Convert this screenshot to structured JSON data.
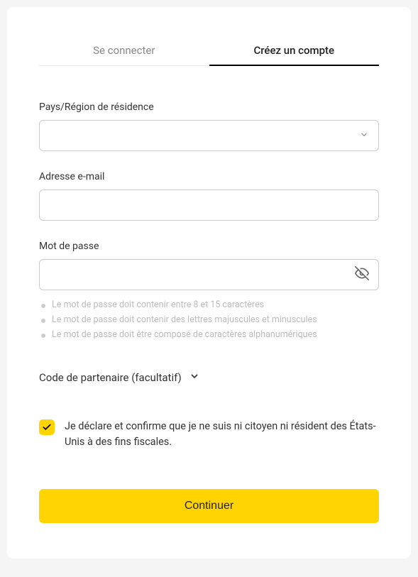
{
  "tabs": {
    "login": "Se connecter",
    "signup": "Créez un compte"
  },
  "form": {
    "country": {
      "label": "Pays/Région de résidence",
      "value": ""
    },
    "email": {
      "label": "Adresse e-mail",
      "value": ""
    },
    "password": {
      "label": "Mot de passe",
      "value": "",
      "hints": [
        "Le mot de passe doit contenir entre 8 et 15 caractères",
        "Le mot de passe doit contenir des lettres majuscules et minuscules",
        "Le mot de passe doit être composé de caractères alphanumériques"
      ]
    },
    "partner": {
      "label": "Code de partenaire (facultatif)"
    },
    "declaration": {
      "checked": true,
      "text": "Je déclare et confirme que je ne suis ni citoyen ni résident des États-Unis à des fins fiscales."
    },
    "submit": "Continuer"
  }
}
